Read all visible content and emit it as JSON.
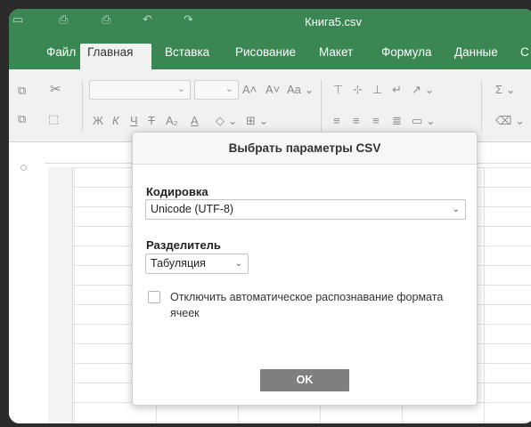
{
  "window": {
    "title": "Книга5.csv"
  },
  "tabs": [
    {
      "label": "Файл"
    },
    {
      "label": "Главная",
      "active": true
    },
    {
      "label": "Вставка"
    },
    {
      "label": "Рисование"
    },
    {
      "label": "Макет"
    },
    {
      "label": "Формула"
    },
    {
      "label": "Данные"
    },
    {
      "label": "С"
    }
  ],
  "ribbon": {
    "font_labels": {
      "bold": "Ж",
      "italic": "К",
      "underline": "Ч",
      "strike": "Т",
      "subscript": "A₂",
      "font_color": "A",
      "increase": "A˄",
      "decrease": "A˅",
      "case": "Aa"
    }
  },
  "dialog": {
    "title": "Выбрать параметры CSV",
    "encoding_label": "Кодировка",
    "encoding_value": "Unicode (UTF-8)",
    "delimiter_label": "Разделитель",
    "delimiter_value": "Табуляция",
    "checkbox_label": "Отключить автоматическое распознавание формата ячеек",
    "checkbox_checked": false,
    "ok_label": "OK"
  },
  "colors": {
    "accent": "#3a8753",
    "ok_button": "#7f7f7f"
  }
}
